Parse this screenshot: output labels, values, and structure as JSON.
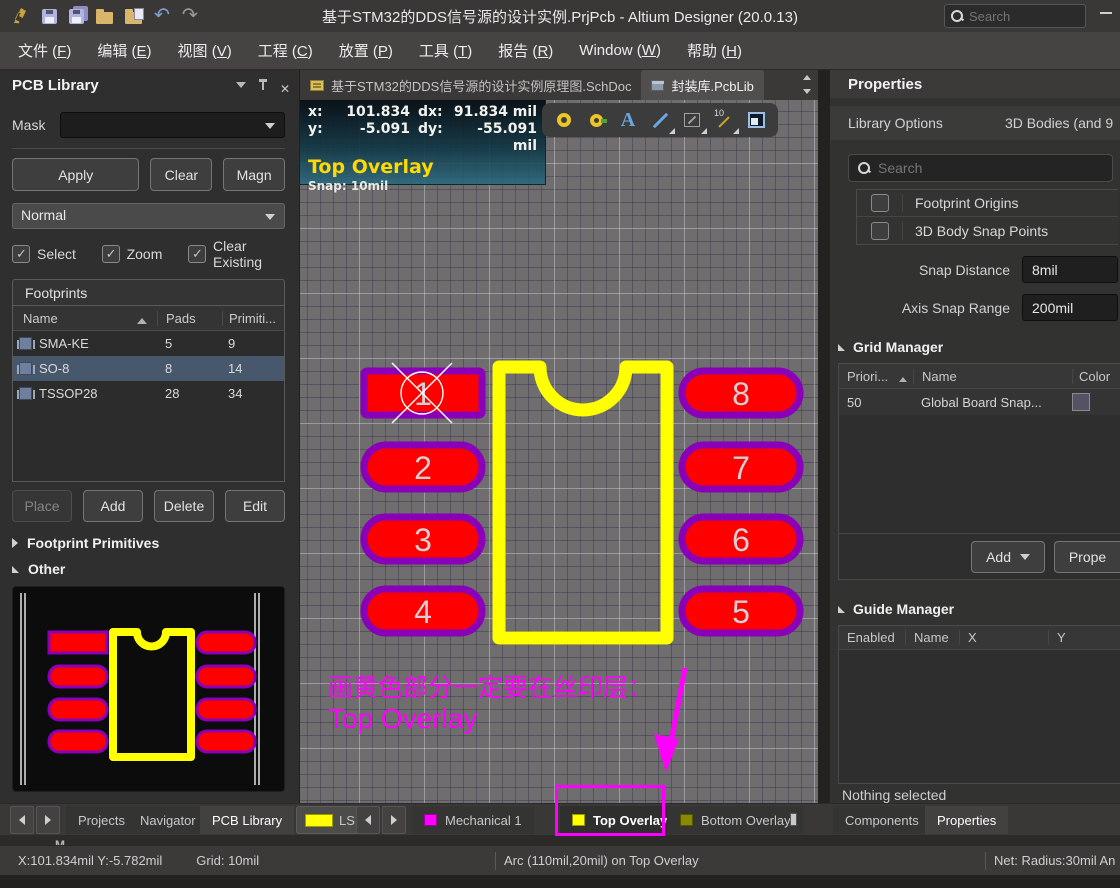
{
  "titlebar": {
    "title": "基于STM32的DDS信号源的设计实例.PrjPcb - Altium Designer (20.0.13)",
    "search_placeholder": "Search"
  },
  "menubar": {
    "items": [
      {
        "pre": "文件 (",
        "key": "F",
        "post": ")"
      },
      {
        "pre": "编辑 (",
        "key": "E",
        "post": ")"
      },
      {
        "pre": "视图 (",
        "key": "V",
        "post": ")"
      },
      {
        "pre": "工程 (",
        "key": "C",
        "post": ")"
      },
      {
        "pre": "放置 (",
        "key": "P",
        "post": ")"
      },
      {
        "pre": "工具 (",
        "key": "T",
        "post": ")"
      },
      {
        "pre": "报告 (",
        "key": "R",
        "post": ")"
      },
      {
        "pre": "Window (",
        "key": "W",
        "post": ")"
      },
      {
        "pre": "帮助 (",
        "key": "H",
        "post": ")"
      }
    ]
  },
  "left_panel": {
    "title": "PCB Library",
    "mask_label": "Mask",
    "apply_label": "Apply",
    "clear_label": "Clear",
    "magn_label": "Magn",
    "mode_value": "Normal",
    "check_select": "Select",
    "check_zoom": "Zoom",
    "check_clear_existing": "Clear Existing",
    "footprints_header": "Footprints",
    "columns": {
      "name": "Name",
      "pads": "Pads",
      "primitives": "Primiti..."
    },
    "rows": [
      {
        "name": "SMA-KE",
        "pads": "5",
        "primitives": "9"
      },
      {
        "name": "SO-8",
        "pads": "8",
        "primitives": "14"
      },
      {
        "name": "TSSOP28",
        "pads": "28",
        "primitives": "34"
      }
    ],
    "place_label": "Place",
    "add_label": "Add",
    "delete_label": "Delete",
    "edit_label": "Edit",
    "section_primitives": "Footprint Primitives",
    "section_other": "Other"
  },
  "doc_tabs": {
    "tabs": [
      {
        "label": "基于STM32的DDS信号源的设计实例原理图.SchDoc"
      },
      {
        "label": "封装库.PcbLib"
      }
    ]
  },
  "hud": {
    "x_label": "x:",
    "x_value": "101.834",
    "dx_label": "dx:",
    "dx_value": "91.834 mil",
    "y_label": "y:",
    "y_value": "-5.091",
    "dy_label": "dy:",
    "dy_value": "-55.091 mil",
    "layer": "Top Overlay",
    "snap": "Snap: 10mil"
  },
  "canvas": {
    "pads": [
      {
        "label": "1"
      },
      {
        "label": "2"
      },
      {
        "label": "3"
      },
      {
        "label": "4"
      },
      {
        "label": "8"
      },
      {
        "label": "7"
      },
      {
        "label": "6"
      },
      {
        "label": "5"
      }
    ],
    "annotation": {
      "line1": "画黄色部分一定要在丝印层：",
      "line2": "Top Overlay"
    }
  },
  "right_panel": {
    "title": "Properties",
    "library_options_label": "Library Options",
    "bodies_label": "3D Bodies (and 9",
    "search_placeholder": "Search",
    "option_rows": [
      {
        "label": "Footprint Origins"
      },
      {
        "label": "3D Body Snap Points"
      }
    ],
    "snap_distance_label": "Snap Distance",
    "snap_distance_value": "8mil",
    "axis_snap_label": "Axis Snap Range",
    "axis_snap_value": "200mil",
    "grid_manager": {
      "title": "Grid Manager",
      "col_priority": "Priori...",
      "col_name": "Name",
      "col_color": "Color",
      "rows": [
        {
          "priority": "50",
          "name": "Global Board Snap..."
        }
      ],
      "add_label": "Add",
      "properties_label": "Prope"
    },
    "guide_manager": {
      "title": "Guide Manager",
      "col_enabled": "Enabled",
      "col_name": "Name",
      "col_x": "X",
      "col_y": "Y"
    },
    "nothing_selected": "Nothing selected"
  },
  "bottom_bar": {
    "panel_tabs": [
      {
        "label": "Projects"
      },
      {
        "label": "Navigator"
      },
      {
        "label": "PCB Library"
      }
    ],
    "ls_label": "LS",
    "layer_tabs": [
      {
        "label": "Mechanical 1"
      },
      {
        "label": "Top Overlay"
      },
      {
        "label": "Bottom Overlay"
      }
    ],
    "right_tabs": [
      {
        "label": "Components"
      },
      {
        "label": "Properties"
      }
    ]
  },
  "statusbar": {
    "coords": "X:101.834mil Y:-5.782mil",
    "grid": "Grid: 10mil",
    "message": "Arc (110mil,20mil) on Top Overlay",
    "net": "Net:  Radius:30mil An"
  },
  "strip_fragment": "M",
  "colors": {
    "accent_magenta": "#FF00FF",
    "silkscreen_yellow": "#FFFF00",
    "pad_red": "#FF0000",
    "pad_ring_purple": "#8A00B8",
    "selection_row": "#47576C",
    "mechanical1_layer": "#FF00FF",
    "top_overlay_layer": "#FFFF00",
    "bottom_overlay_layer": "#8A8A00",
    "grid_color_swatch": "#565165"
  }
}
